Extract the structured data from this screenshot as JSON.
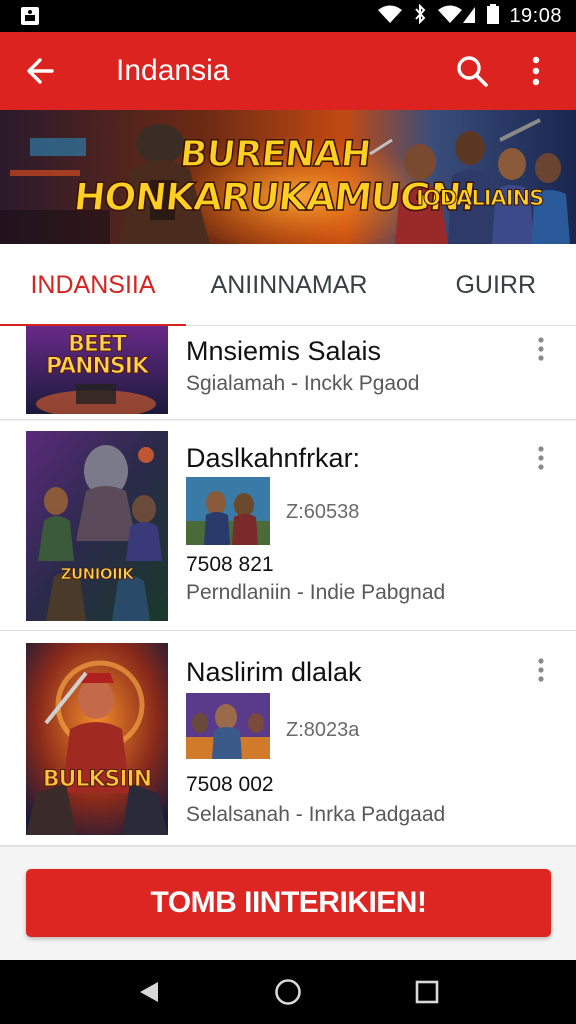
{
  "status_bar": {
    "time": "19:08",
    "icons": [
      "notification-icon",
      "wifi-icon",
      "bluetooth-icon",
      "signal-icon",
      "battery-icon"
    ]
  },
  "app_bar": {
    "title": "Indansia",
    "back_icon": "arrow-back-icon",
    "search_icon": "search-icon",
    "more_icon": "more-vert-icon"
  },
  "banner": {
    "line1": "BURENAH",
    "line2": "HONKARUKAMUGN!",
    "logo_text": "IODALIAINS"
  },
  "tabs": [
    {
      "label": "INDANSIIA",
      "selected": true
    },
    {
      "label": "ANIINNAMAR",
      "selected": false
    },
    {
      "label": "GUIRR",
      "selected": false
    }
  ],
  "list": {
    "items": [
      {
        "title": "Mnsiemis Salais",
        "subtitle": "Sgialamah - Inckk Pgaod",
        "thumb_label": "BEET PANNSIK"
      },
      {
        "title": "Daslkahnfrkar:",
        "code": "Z:60538",
        "price": "7508 821",
        "subtitle": "Perndlaniin - Indie Pabgnad",
        "thumb_label": "ZUNIOIIK"
      },
      {
        "title": "Naslirim dlalak",
        "code": "Z:8023a",
        "price": "7508 002",
        "subtitle": "Selalsanah - Inrka Padgaad",
        "thumb_label": "BULKSIIN"
      }
    ]
  },
  "cta": {
    "label": "TOMB IINTERIKIEN!"
  },
  "colors": {
    "primary": "#dc2320",
    "accent_text": "#d52320",
    "status_bar": "#000000"
  }
}
